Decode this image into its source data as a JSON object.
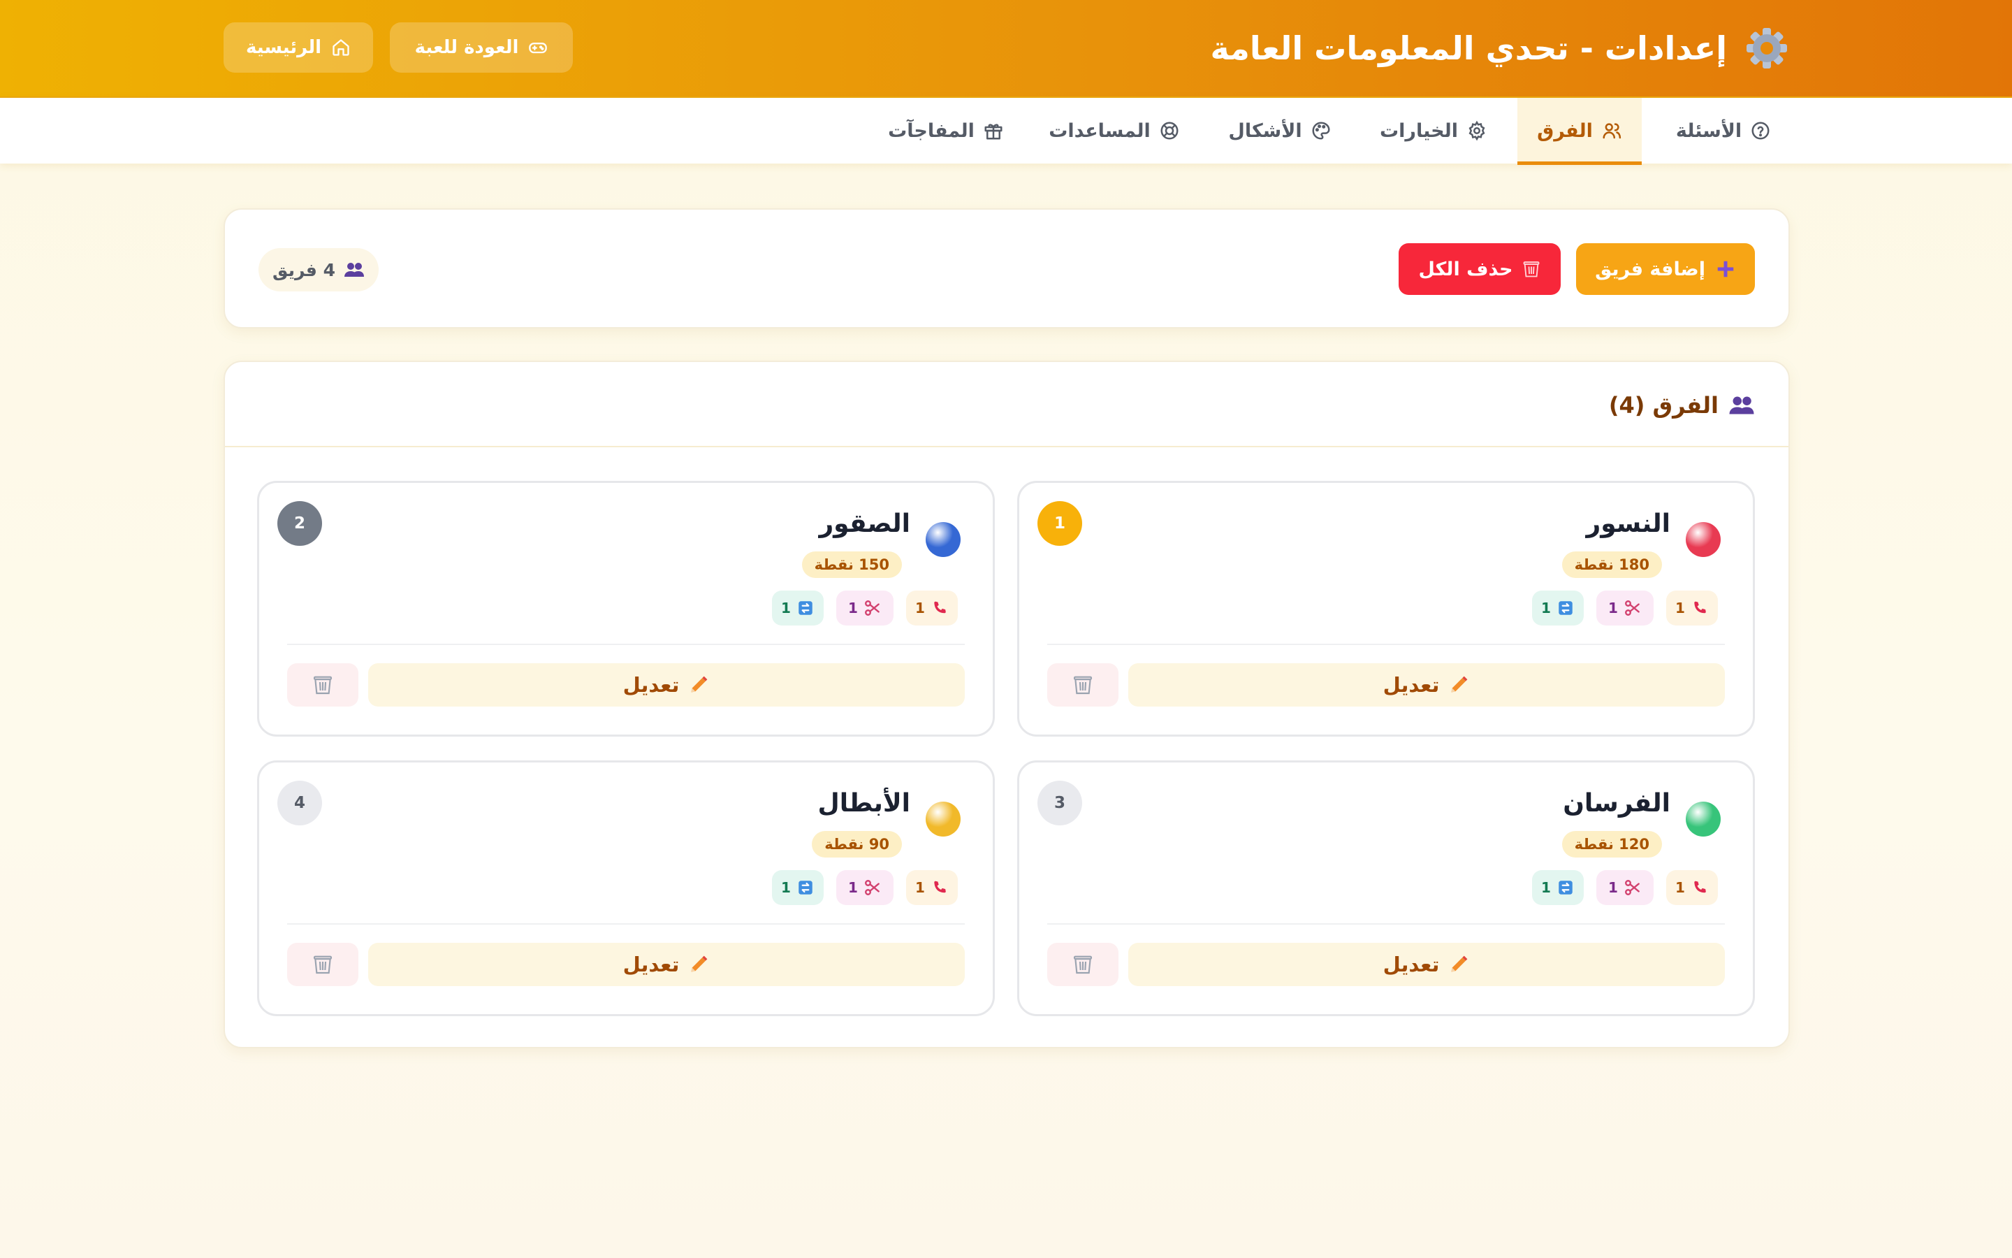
{
  "header": {
    "title": "إعدادات - تحدي المعلومات العامة",
    "back_label": "العودة للعبة",
    "home_label": "الرئيسية"
  },
  "tabs": [
    {
      "label": "الأسئلة",
      "icon": "help-circle-icon",
      "active": false
    },
    {
      "label": "الفرق",
      "icon": "users-icon",
      "active": true
    },
    {
      "label": "الخيارات",
      "icon": "gear-icon",
      "active": false
    },
    {
      "label": "الأشكال",
      "icon": "palette-icon",
      "active": false
    },
    {
      "label": "المساعدات",
      "icon": "lifebuoy-icon",
      "active": false
    },
    {
      "label": "المفاجآت",
      "icon": "gift-icon",
      "active": false
    }
  ],
  "toolbar": {
    "add_label": "إضافة فريق",
    "clear_label": "حذف الكل",
    "count_label": "4 فريق"
  },
  "teams_section": {
    "title": "الفرق (4)"
  },
  "teams": [
    {
      "name": "النسور",
      "points": "180 نقطة",
      "rank": "1",
      "color": "#e83a52",
      "aids": {
        "call": "1",
        "cut": "1",
        "swap": "1"
      },
      "edit_label": "تعديل"
    },
    {
      "name": "الصقور",
      "points": "150 نقطة",
      "rank": "2",
      "color": "#3568d4",
      "aids": {
        "call": "1",
        "cut": "1",
        "swap": "1"
      },
      "edit_label": "تعديل"
    },
    {
      "name": "الفرسان",
      "points": "120 نقطة",
      "rank": "3",
      "color": "#37c47a",
      "aids": {
        "call": "1",
        "cut": "1",
        "swap": "1"
      },
      "edit_label": "تعديل"
    },
    {
      "name": "الأبطال",
      "points": "90 نقطة",
      "rank": "4",
      "color": "#f1b92a",
      "aids": {
        "call": "1",
        "cut": "1",
        "swap": "1"
      },
      "edit_label": "تعديل"
    }
  ],
  "colors": {
    "header_start": "#efb103",
    "header_end": "#e27507",
    "accent": "#f7a515",
    "danger": "#f7273a"
  }
}
